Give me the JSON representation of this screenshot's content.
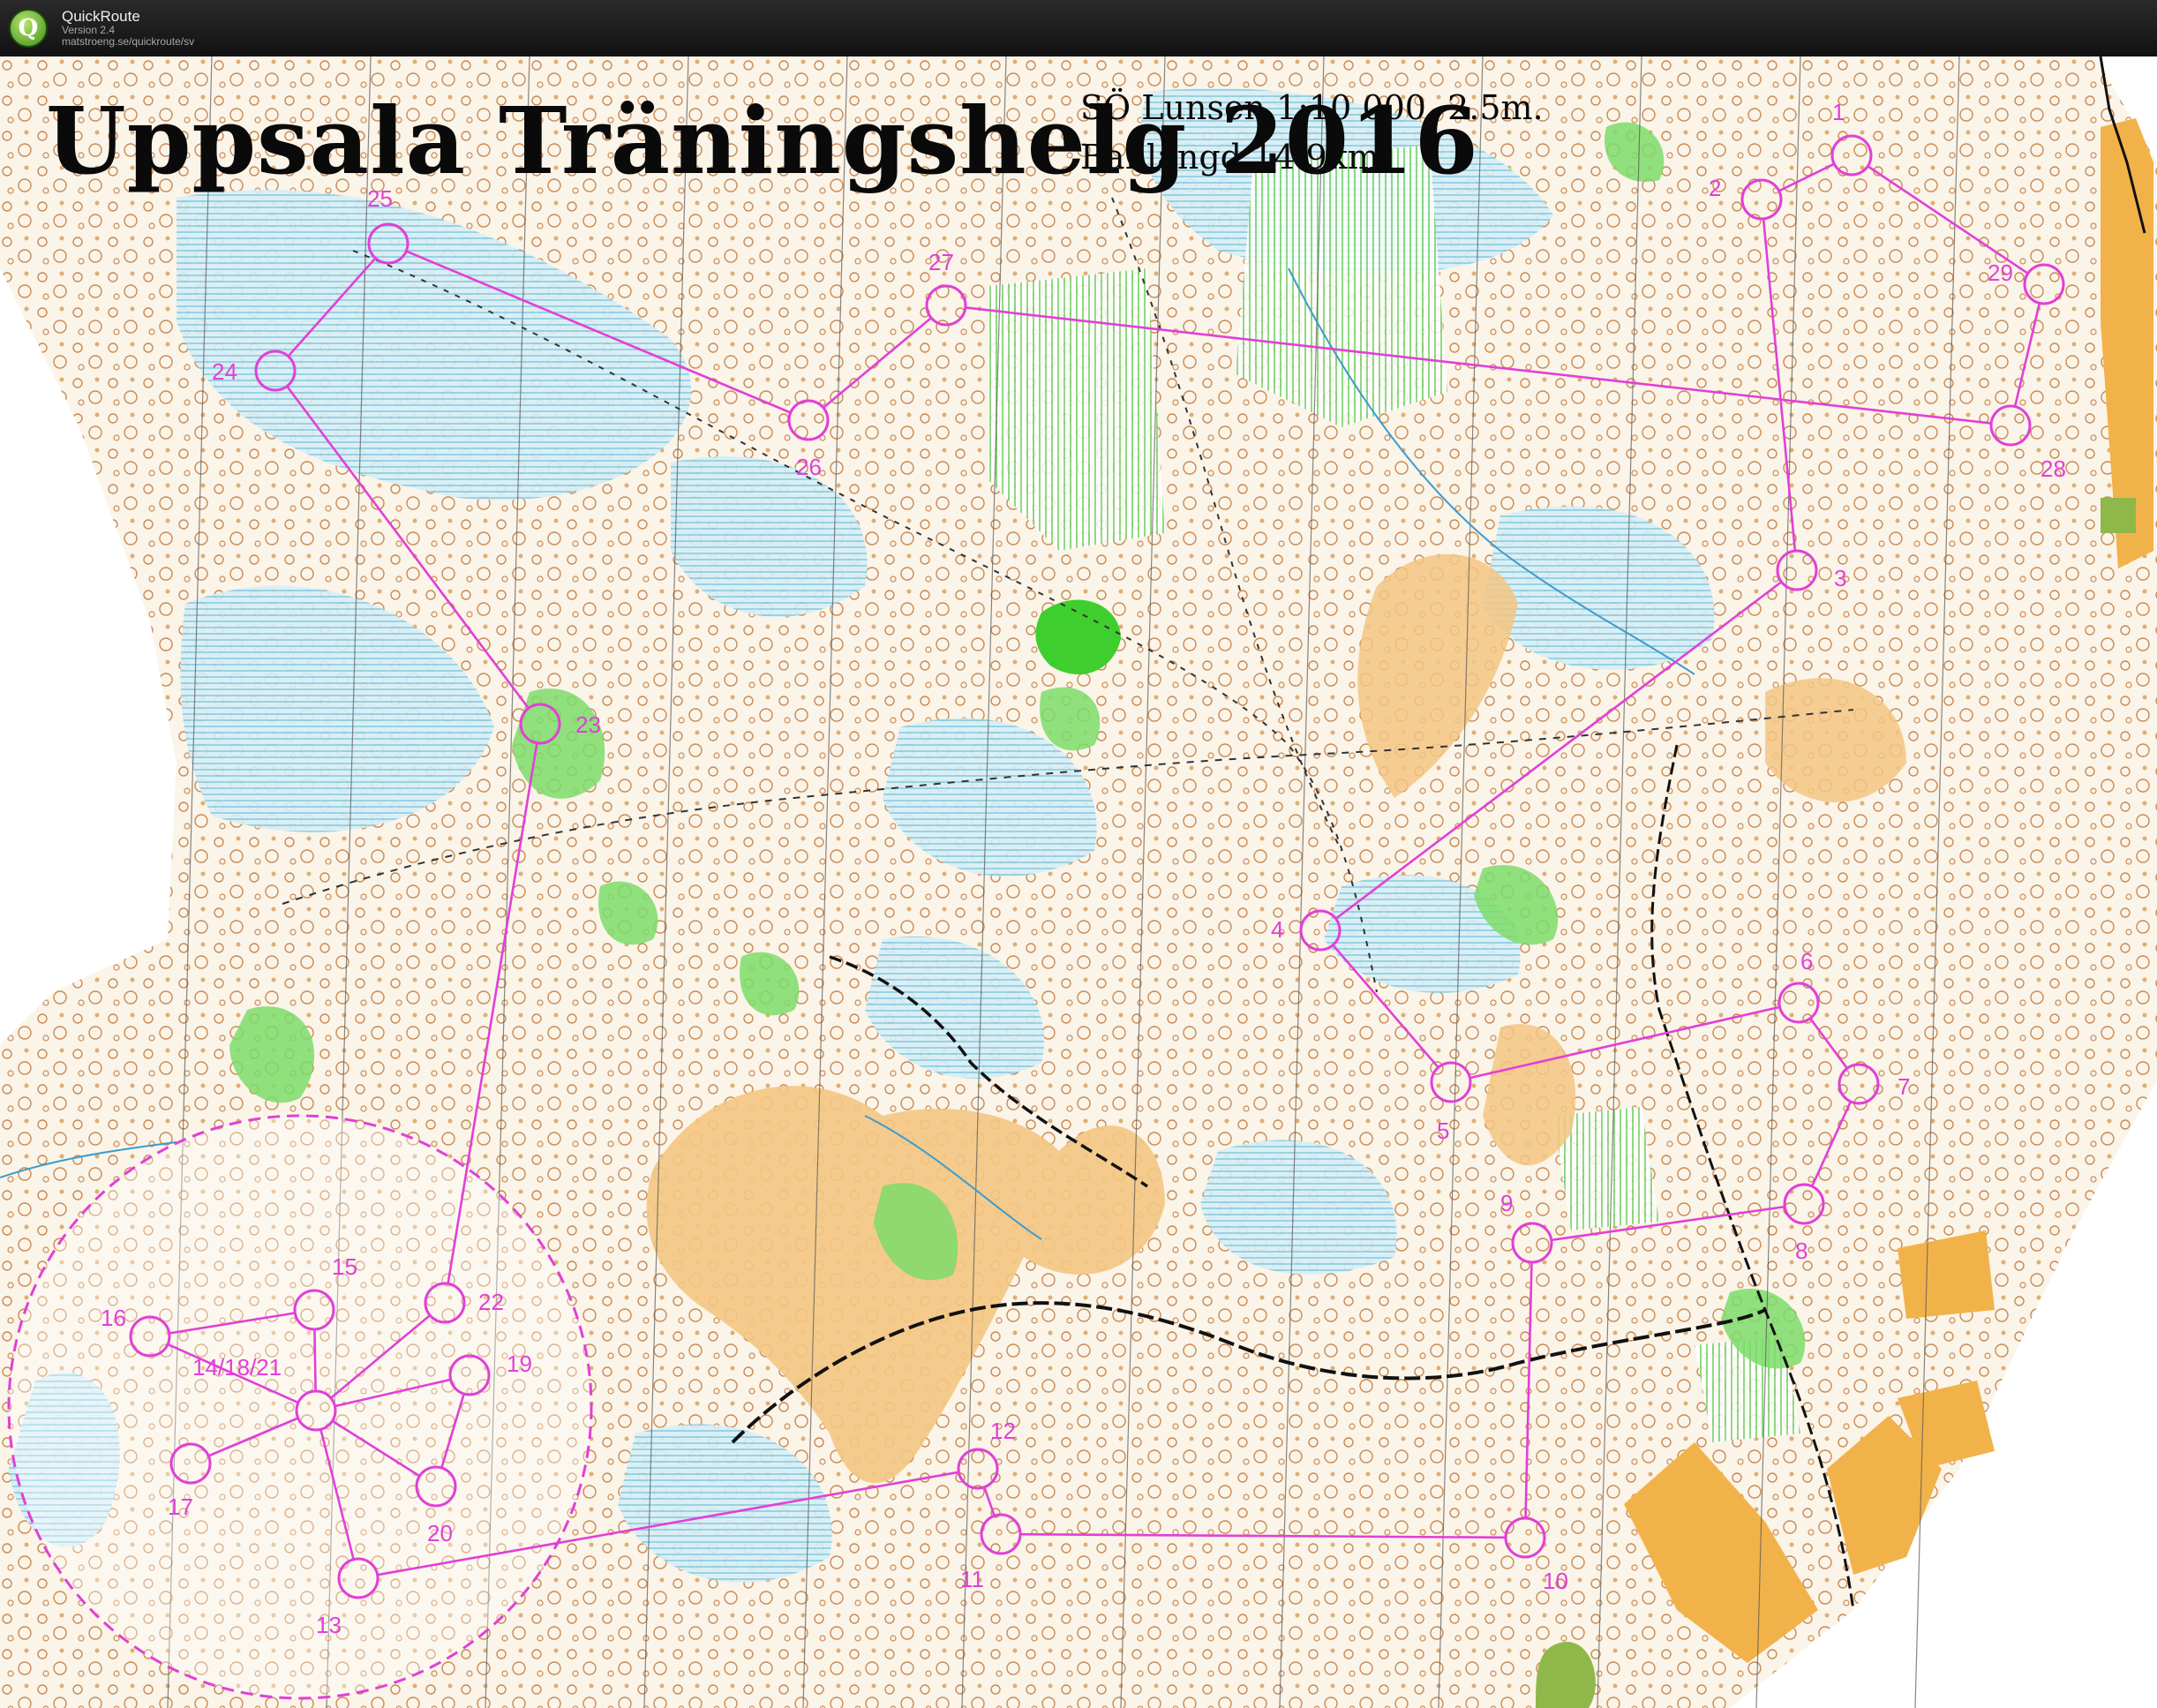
{
  "app": {
    "name": "QuickRoute",
    "version": "Version 2.4",
    "url": "matstroeng.se/quickroute/sv",
    "logo_letter": "Q"
  },
  "map": {
    "title": "Uppsala Träningshelg 2016",
    "scale_line": "SÖ Lunsen 1:10 000. 2.5m.",
    "length_line": "Banlängd 14.9km"
  },
  "colors": {
    "course": "#e23fd8",
    "open_land": "#f5c98a",
    "green_vegetation": "#66d65a",
    "marsh_blue": "#8fd3e8",
    "contour_brown": "#b0611f",
    "background": "#ffffff"
  },
  "controls": [
    {
      "label": "1"
    },
    {
      "label": "2"
    },
    {
      "label": "3"
    },
    {
      "label": "4"
    },
    {
      "label": "5"
    },
    {
      "label": "6"
    },
    {
      "label": "7"
    },
    {
      "label": "8"
    },
    {
      "label": "9"
    },
    {
      "label": "10"
    },
    {
      "label": "11"
    },
    {
      "label": "12"
    },
    {
      "label": "13"
    },
    {
      "label": "14/18/21"
    },
    {
      "label": "15"
    },
    {
      "label": "16"
    },
    {
      "label": "17"
    },
    {
      "label": "19"
    },
    {
      "label": "20"
    },
    {
      "label": "22"
    },
    {
      "label": "23"
    },
    {
      "label": "24"
    },
    {
      "label": "25"
    },
    {
      "label": "26"
    },
    {
      "label": "27"
    },
    {
      "label": "28"
    },
    {
      "label": "29"
    }
  ]
}
